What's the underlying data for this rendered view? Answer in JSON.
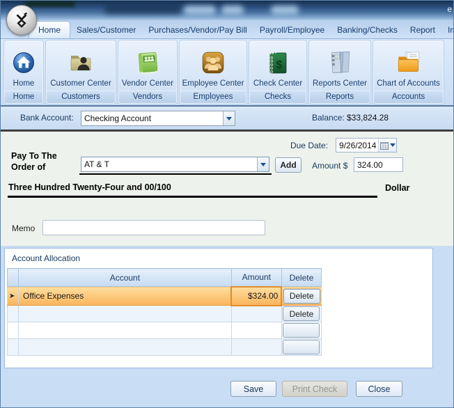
{
  "window": {
    "edge_text": "e"
  },
  "tabs": [
    {
      "label": "Home"
    },
    {
      "label": "Sales/Customer"
    },
    {
      "label": "Purchases/Vendor/Pay Bill"
    },
    {
      "label": "Payroll/Employee"
    },
    {
      "label": "Banking/Checks"
    },
    {
      "label": "Report"
    },
    {
      "label": "Import/Exp"
    }
  ],
  "ribbon": {
    "groups": [
      {
        "label": "Home",
        "caption": "Home"
      },
      {
        "label": "Customer Center",
        "caption": "Customers"
      },
      {
        "label": "Vendor Center",
        "caption": "Vendors"
      },
      {
        "label": "Employee Center",
        "caption": "Employees"
      },
      {
        "label": "Check Center",
        "caption": "Checks"
      },
      {
        "label": "Reports Center",
        "caption": "Reports"
      },
      {
        "label": "Chart of Accounts",
        "caption": "Accounts"
      }
    ]
  },
  "bank": {
    "label": "Bank Account:",
    "value": "Checking Account",
    "balance_label": "Balance:",
    "balance_value": "$33,824.28"
  },
  "check": {
    "due_date_label": "Due Date:",
    "due_date": "9/26/2014",
    "pay_to_line1": "Pay To The",
    "pay_to_line2": "Order of",
    "payee": "AT & T",
    "add_label": "Add",
    "amount_label": "Amount $",
    "amount": "324.00",
    "amount_words": "Three Hundred Twenty-Four and 00/100",
    "dollar_label": "Dollar",
    "memo_label": "Memo",
    "memo_value": ""
  },
  "allocation": {
    "title": "Account Allocation",
    "headers": [
      "Account",
      "Amount",
      "Delete"
    ],
    "rows": [
      {
        "account": "Office Expenses",
        "amount": "$324.00",
        "delete_label": "Delete",
        "selected": true
      },
      {
        "account": "",
        "amount": "",
        "delete_label": "Delete",
        "selected": false
      },
      {
        "account": "",
        "amount": "",
        "delete_label": "",
        "selected": false
      },
      {
        "account": "",
        "amount": "",
        "delete_label": "",
        "selected": false
      }
    ]
  },
  "footer": {
    "save": "Save",
    "print": "Print Check",
    "close": "Close"
  },
  "colors": {
    "selection_orange": "#fbb45c",
    "amount_cell_border": "#e08c2d",
    "ribbon_blue": "#c9dcf3",
    "tab_text": "#163d6d"
  }
}
